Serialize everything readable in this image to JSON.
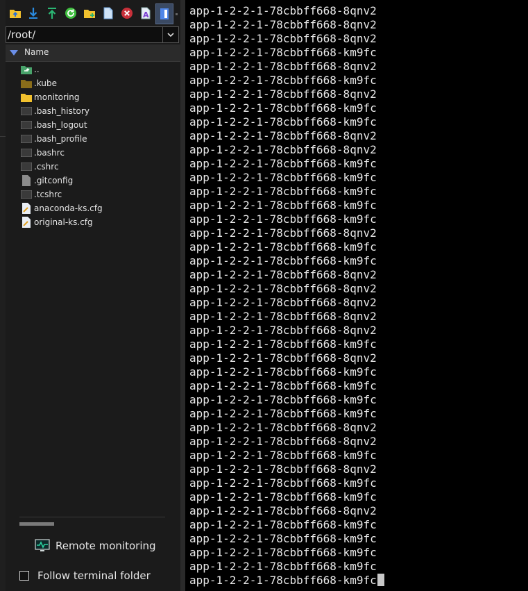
{
  "toolbar": {
    "icons": [
      "folder-up-icon",
      "download-icon",
      "upload-icon",
      "refresh-icon",
      "new-folder-icon",
      "new-file-icon",
      "delete-icon",
      "rename-icon",
      "toggle-view-icon"
    ]
  },
  "path": {
    "value": "/root/"
  },
  "tree_header": {
    "name_label": "Name"
  },
  "files": [
    {
      "name": "..",
      "icon": "parent-folder-icon"
    },
    {
      "name": ".kube",
      "icon": "folder-dark-icon"
    },
    {
      "name": "monitoring",
      "icon": "folder-icon"
    },
    {
      "name": ".bash_history",
      "icon": "terminal-file-icon"
    },
    {
      "name": ".bash_logout",
      "icon": "terminal-file-icon"
    },
    {
      "name": ".bash_profile",
      "icon": "terminal-file-icon"
    },
    {
      "name": ".bashrc",
      "icon": "terminal-file-icon"
    },
    {
      "name": ".cshrc",
      "icon": "terminal-file-icon"
    },
    {
      "name": ".gitconfig",
      "icon": "file-icon"
    },
    {
      "name": ".tcshrc",
      "icon": "terminal-file-icon"
    },
    {
      "name": "anaconda-ks.cfg",
      "icon": "config-file-icon"
    },
    {
      "name": "original-ks.cfg",
      "icon": "config-file-icon"
    }
  ],
  "remote_monitoring": {
    "label": "Remote monitoring"
  },
  "follow_terminal": {
    "label": "Follow terminal folder",
    "checked": false
  },
  "terminal": {
    "lines": [
      "app-1-2-2-1-78cbbff668-8qnv2",
      "app-1-2-2-1-78cbbff668-8qnv2",
      "app-1-2-2-1-78cbbff668-8qnv2",
      "app-1-2-2-1-78cbbff668-km9fc",
      "app-1-2-2-1-78cbbff668-8qnv2",
      "app-1-2-2-1-78cbbff668-km9fc",
      "app-1-2-2-1-78cbbff668-8qnv2",
      "app-1-2-2-1-78cbbff668-km9fc",
      "app-1-2-2-1-78cbbff668-km9fc",
      "app-1-2-2-1-78cbbff668-8qnv2",
      "app-1-2-2-1-78cbbff668-8qnv2",
      "app-1-2-2-1-78cbbff668-km9fc",
      "app-1-2-2-1-78cbbff668-km9fc",
      "app-1-2-2-1-78cbbff668-km9fc",
      "app-1-2-2-1-78cbbff668-km9fc",
      "app-1-2-2-1-78cbbff668-km9fc",
      "app-1-2-2-1-78cbbff668-8qnv2",
      "app-1-2-2-1-78cbbff668-km9fc",
      "app-1-2-2-1-78cbbff668-km9fc",
      "app-1-2-2-1-78cbbff668-8qnv2",
      "app-1-2-2-1-78cbbff668-8qnv2",
      "app-1-2-2-1-78cbbff668-8qnv2",
      "app-1-2-2-1-78cbbff668-8qnv2",
      "app-1-2-2-1-78cbbff668-8qnv2",
      "app-1-2-2-1-78cbbff668-km9fc",
      "app-1-2-2-1-78cbbff668-8qnv2",
      "app-1-2-2-1-78cbbff668-km9fc",
      "app-1-2-2-1-78cbbff668-km9fc",
      "app-1-2-2-1-78cbbff668-km9fc",
      "app-1-2-2-1-78cbbff668-km9fc",
      "app-1-2-2-1-78cbbff668-8qnv2",
      "app-1-2-2-1-78cbbff668-8qnv2",
      "app-1-2-2-1-78cbbff668-km9fc",
      "app-1-2-2-1-78cbbff668-8qnv2",
      "app-1-2-2-1-78cbbff668-km9fc",
      "app-1-2-2-1-78cbbff668-km9fc",
      "app-1-2-2-1-78cbbff668-8qnv2",
      "app-1-2-2-1-78cbbff668-km9fc",
      "app-1-2-2-1-78cbbff668-km9fc",
      "app-1-2-2-1-78cbbff668-km9fc",
      "app-1-2-2-1-78cbbff668-km9fc",
      "app-1-2-2-1-78cbbff668-km9fc"
    ]
  },
  "colors": {
    "folder": "#f2c12e",
    "folder_dark": "#8a6d1a",
    "terminal_bg": "#000000",
    "accent_green": "#2bb673"
  }
}
